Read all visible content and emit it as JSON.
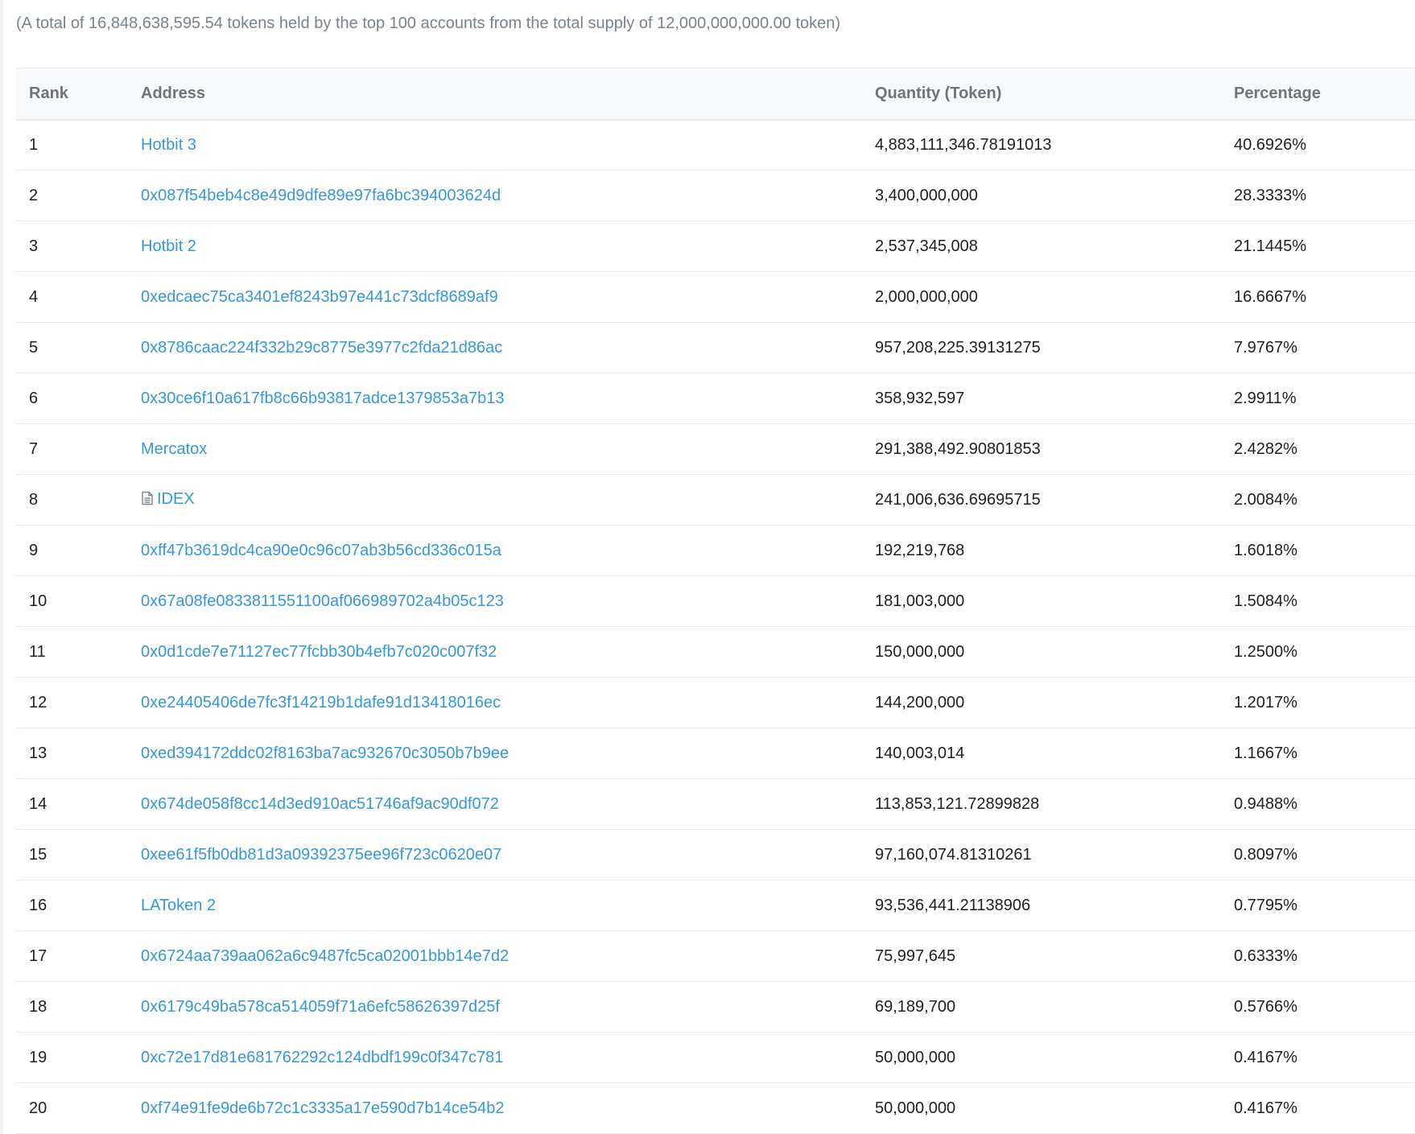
{
  "summary": "(A total of 16,848,638,595.54 tokens held by the top 100 accounts from the total supply of 12,000,000,000.00 token)",
  "table": {
    "headers": {
      "rank": "Rank",
      "address": "Address",
      "quantity": "Quantity (Token)",
      "percentage": "Percentage"
    },
    "rows": [
      {
        "rank": "1",
        "address": "Hotbit 3",
        "quantity": "4,883,111,346.78191013",
        "percentage": "40.6926%",
        "contract": false
      },
      {
        "rank": "2",
        "address": "0x087f54beb4c8e49d9dfe89e97fa6bc394003624d",
        "quantity": "3,400,000,000",
        "percentage": "28.3333%",
        "contract": false
      },
      {
        "rank": "3",
        "address": "Hotbit 2",
        "quantity": "2,537,345,008",
        "percentage": "21.1445%",
        "contract": false
      },
      {
        "rank": "4",
        "address": "0xedcaec75ca3401ef8243b97e441c73dcf8689af9",
        "quantity": "2,000,000,000",
        "percentage": "16.6667%",
        "contract": false
      },
      {
        "rank": "5",
        "address": "0x8786caac224f332b29c8775e3977c2fda21d86ac",
        "quantity": "957,208,225.39131275",
        "percentage": "7.9767%",
        "contract": false
      },
      {
        "rank": "6",
        "address": "0x30ce6f10a617fb8c66b93817adce1379853a7b13",
        "quantity": "358,932,597",
        "percentage": "2.9911%",
        "contract": false
      },
      {
        "rank": "7",
        "address": "Mercatox",
        "quantity": "291,388,492.90801853",
        "percentage": "2.4282%",
        "contract": false
      },
      {
        "rank": "8",
        "address": "IDEX",
        "quantity": "241,006,636.69695715",
        "percentage": "2.0084%",
        "contract": true
      },
      {
        "rank": "9",
        "address": "0xff47b3619dc4ca90e0c96c07ab3b56cd336c015a",
        "quantity": "192,219,768",
        "percentage": "1.6018%",
        "contract": false
      },
      {
        "rank": "10",
        "address": "0x67a08fe0833811551100af066989702a4b05c123",
        "quantity": "181,003,000",
        "percentage": "1.5084%",
        "contract": false
      },
      {
        "rank": "11",
        "address": "0x0d1cde7e71127ec77fcbb30b4efb7c020c007f32",
        "quantity": "150,000,000",
        "percentage": "1.2500%",
        "contract": false
      },
      {
        "rank": "12",
        "address": "0xe24405406de7fc3f14219b1dafe91d13418016ec",
        "quantity": "144,200,000",
        "percentage": "1.2017%",
        "contract": false
      },
      {
        "rank": "13",
        "address": "0xed394172ddc02f8163ba7ac932670c3050b7b9ee",
        "quantity": "140,003,014",
        "percentage": "1.1667%",
        "contract": false
      },
      {
        "rank": "14",
        "address": "0x674de058f8cc14d3ed910ac51746af9ac90df072",
        "quantity": "113,853,121.72899828",
        "percentage": "0.9488%",
        "contract": false
      },
      {
        "rank": "15",
        "address": "0xee61f5fb0db81d3a09392375ee96f723c0620e07",
        "quantity": "97,160,074.81310261",
        "percentage": "0.8097%",
        "contract": false
      },
      {
        "rank": "16",
        "address": "LAToken 2",
        "quantity": "93,536,441.21138906",
        "percentage": "0.7795%",
        "contract": false
      },
      {
        "rank": "17",
        "address": "0x6724aa739aa062a6c9487fc5ca02001bbb14e7d2",
        "quantity": "75,997,645",
        "percentage": "0.6333%",
        "contract": false
      },
      {
        "rank": "18",
        "address": "0x6179c49ba578ca514059f71a6efc58626397d25f",
        "quantity": "69,189,700",
        "percentage": "0.5766%",
        "contract": false
      },
      {
        "rank": "19",
        "address": "0xc72e17d81e681762292c124dbdf199c0f347c781",
        "quantity": "50,000,000",
        "percentage": "0.4167%",
        "contract": false
      },
      {
        "rank": "20",
        "address": "0xf74e91fe9de6b72c1c3335a17e590d7b14ce54b2",
        "quantity": "50,000,000",
        "percentage": "0.4167%",
        "contract": false
      }
    ]
  },
  "icons": {
    "contract": "file-text-icon"
  },
  "colors": {
    "link": "#3498db",
    "muted": "#77838f",
    "header_bg": "#f8f9fa",
    "border": "#e7eaf3"
  }
}
